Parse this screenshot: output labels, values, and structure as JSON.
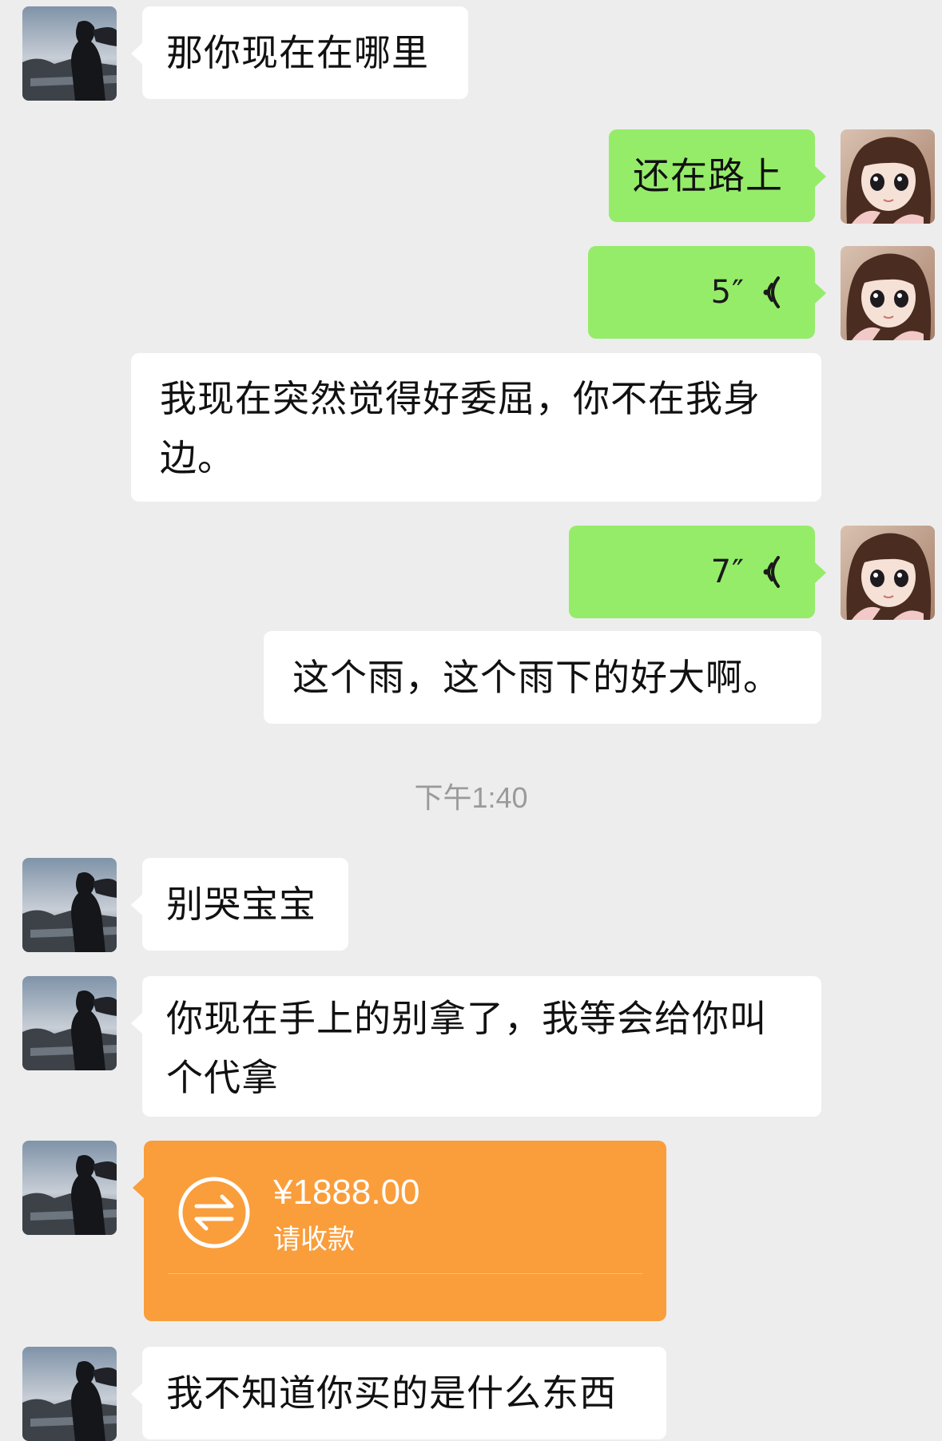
{
  "messages": [
    {
      "side": "left",
      "text": "那你现在在哪里"
    },
    {
      "side": "right",
      "text": "还在路上"
    },
    {
      "side": "right",
      "voice_duration": "5″"
    },
    {
      "side": "left",
      "text": "我现在突然觉得好委屈，你不在我身边。"
    },
    {
      "side": "right",
      "voice_duration": "7″"
    },
    {
      "side": "left",
      "text": "这个雨，这个雨下的好大啊。"
    },
    {
      "side": "left",
      "text": "别哭宝宝"
    },
    {
      "side": "left",
      "text": "你现在手上的别拿了，我等会给你叫个代拿"
    },
    {
      "side": "left",
      "transfer": {
        "amount": "¥1888.00",
        "status": "请收款"
      }
    },
    {
      "side": "left",
      "text": "我不知道你买的是什么东西"
    }
  ],
  "msg1": {
    "text": "那你现在在哪里"
  },
  "msg2": {
    "text": "还在路上"
  },
  "msg3": {
    "duration": "5″"
  },
  "msg4": {
    "line1": "我现在突然觉得好委屈，你不在我身",
    "line2": "边。"
  },
  "msg5": {
    "duration": "7″"
  },
  "msg6": {
    "text": "这个雨，这个雨下的好大啊。"
  },
  "timestamp": "下午1:40",
  "msg7": {
    "text": "别哭宝宝"
  },
  "msg8": {
    "line1": "你现在手上的别拿了，我等会给你叫",
    "line2": "个代拿"
  },
  "transfer": {
    "amount": "¥1888.00",
    "status": "请收款",
    "color": "#fa9d3b"
  },
  "msg10": {
    "text": "我不知道你买的是什么东西"
  },
  "colors": {
    "background": "#ededed",
    "left_bubble": "#ffffff",
    "right_bubble": "#95ec69",
    "timestamp": "#9a9a9a"
  },
  "icons": {
    "left_avatar": "person-by-sea-avatar",
    "right_avatar": "doll-girl-avatar",
    "voice": "voice-wave-icon",
    "transfer": "transfer-arrows-icon"
  }
}
